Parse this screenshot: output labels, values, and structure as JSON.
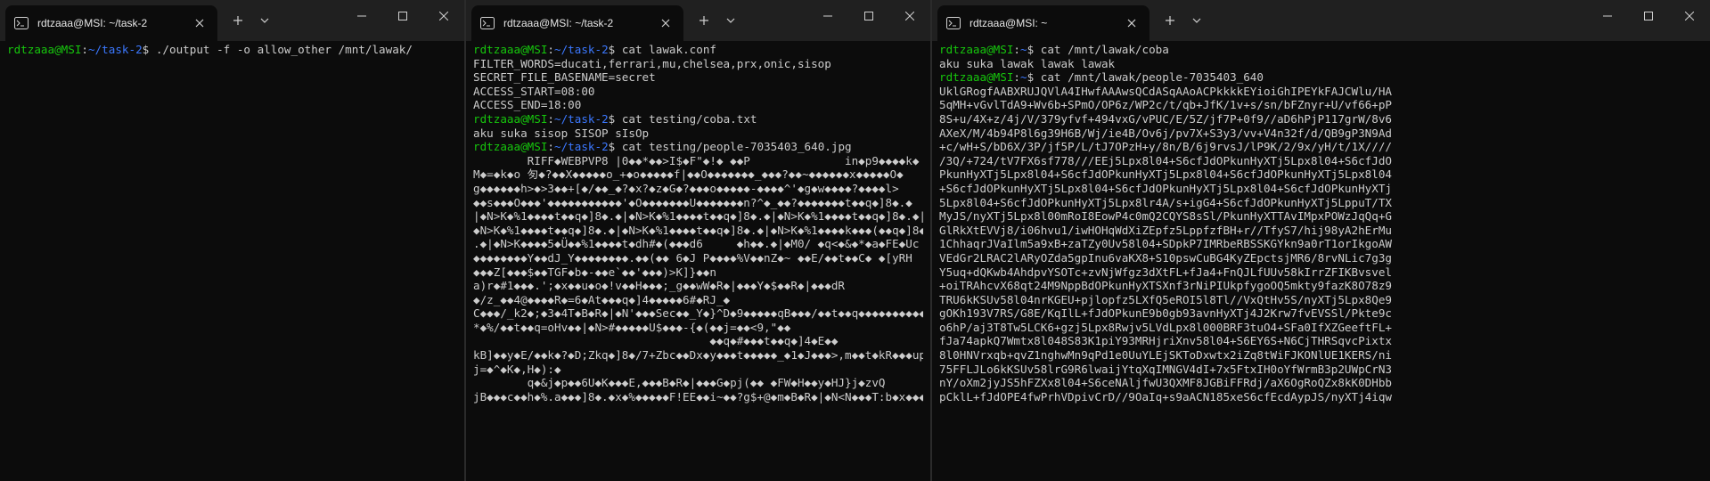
{
  "windows": [
    {
      "tab_title": "rdtzaaa@MSI: ~/task-2",
      "lines": [
        {
          "type": "prompt",
          "user": "rdtzaaa@MSI",
          "colon": ":",
          "path": "~/task-2",
          "dollar": "$ ",
          "cmd": "./output -f -o allow_other /mnt/lawak/"
        }
      ]
    },
    {
      "tab_title": "rdtzaaa@MSI: ~/task-2",
      "lines": [
        {
          "type": "prompt",
          "user": "rdtzaaa@MSI",
          "colon": ":",
          "path": "~/task-2",
          "dollar": "$ ",
          "cmd": "cat lawak.conf"
        },
        {
          "type": "out",
          "text": "FILTER_WORDS=ducati,ferrari,mu,chelsea,prx,onic,sisop"
        },
        {
          "type": "out",
          "text": "SECRET_FILE_BASENAME=secret"
        },
        {
          "type": "out",
          "text": "ACCESS_START=08:00"
        },
        {
          "type": "out",
          "text": "ACCESS_END=18:00"
        },
        {
          "type": "prompt",
          "user": "rdtzaaa@MSI",
          "colon": ":",
          "path": "~/task-2",
          "dollar": "$ ",
          "cmd": "cat testing/coba.txt"
        },
        {
          "type": "out",
          "text": "aku suka sisop SISOP sIsOp"
        },
        {
          "type": "prompt",
          "user": "rdtzaaa@MSI",
          "colon": ":",
          "path": "~/task-2",
          "dollar": "$ ",
          "cmd": "cat testing/people-7035403_640.jpg"
        },
        {
          "type": "out",
          "text": "        RIFF◆WEBPVP8 |0◆◆*◆◆>I$◆F\"◆!◆ ◆◆P              in◆p9◆◆◆◆k◆"
        },
        {
          "type": "out",
          "text": "M◆=◆k◆o 匇◆?◆◆X◆◆◆◆◆o_+◆o◆◆◆◆◆f|◆◆O◆◆◆◆◆◆◆_◆◆◆?◆◆~◆◆◆◆◆◆x◆◆◆◆◆O◆"
        },
        {
          "type": "out",
          "text": "g◆◆◆◆◆◆h>◆>3◆◆+[◆/◆◆_◆?◆x?◆z◆G◆?◆◆◆o◆◆◆◆◆-◆◆◆◆^'◆g◆w◆◆◆◆?◆◆◆◆l>"
        },
        {
          "type": "out",
          "text": "◆◆s◆◆◆O◆◆◆'◆◆◆◆◆◆◆◆◆◆◆'◆O◆◆◆◆◆◆◆U◆◆◆◆◆◆◆n?^◆_◆◆?◆◆◆◆◆◆◆t◆◆q◆]8◆.◆"
        },
        {
          "type": "out",
          "text": "|◆N>K◆%1◆◆◆◆t◆◆q◆]8◆.◆|◆N>K◆%1◆◆◆◆t◆◆q◆]8◆.◆|◆N>K◆%1◆◆◆◆t◆◆q◆]8◆.◆|"
        },
        {
          "type": "out",
          "text": "◆N>K◆%1◆◆◆◆t◆◆q◆]8◆.◆|◆N>K◆%1◆◆◆◆t◆◆q◆]8◆.◆|◆N>K◆%1◆◆◆◆k◆◆◆(◆◆q◆]8◆"
        },
        {
          "type": "out",
          "text": ".◆|◆N>K◆◆◆◆5◆Ü◆◆%1◆◆◆◆t◆dh#◆(◆◆◆d6     ◆h◆◆.◆|◆M0/ ◆q<◆&◆*◆a◆FE◆Uc"
        },
        {
          "type": "out",
          "text": "◆◆◆◆◆◆◆◆Y◆◆dJ_Y◆◆◆◆◆◆◆◆.◆◆(◆◆ 6◆J P◆◆◆◆%V◆◆nZ◆~ ◆◆E/◆◆t◆◆C◆ ◆[yRH"
        },
        {
          "type": "out",
          "text": "◆◆◆Z[◆◆◆$◆◆TGF◆b◆-◆◆e`◆◆'◆◆◆)>K]}◆◆n"
        },
        {
          "type": "out",
          "text": "a)r◆#1◆◆◆.';◆x◆◆u◆o◆!v◆◆H◆◆◆;_g◆◆wW◆R◆|◆◆◆Y◆$◆◆R◆|◆◆◆dR"
        },
        {
          "type": "out",
          "text": "◆/z_◆◆4@◆◆◆◆R◆=6◆At◆◆◆q◆]4◆◆◆◆◆6#◆RJ_◆"
        },
        {
          "type": "out",
          "text": "C◆◆◆/_k2◆;◆3◆4T◆B◆R◆|◆N'◆◆◆Sec◆◆_Y◆}^D◆9◆◆◆◆◆qB◆◆◆/◆◆t◆◆q◆◆◆◆◆◆◆◆◆◆?"
        },
        {
          "type": "out",
          "text": "*◆%/◆◆t◆◆q=oHv◆◆|◆N>#◆◆◆◆◆U$◆◆◆-{◆(◆◆j=◆◆<9,\"◆◆"
        },
        {
          "type": "out",
          "text": "                                   ◆◆q◆#◆◆◆t◆◆q◆]4◆E◆◆"
        },
        {
          "type": "out",
          "text": "kB]◆◆y◆E/◆◆k◆?◆D;Zkq◆]8◆/7+Zbc◆◆Dx◆y◆◆◆t◆◆◆◆◆_◆1◆J◆◆◆>,m◆◆t◆kR◆◆◆up2"
        },
        {
          "type": "out",
          "text": "j=◆^◆K◆,H◆):◆"
        },
        {
          "type": "out",
          "text": "        q◆&j◆p◆◆6U◆K◆◆◆E,◆◆◆B◆R◆|◆◆◆G◆pj(◆◆ ◆FW◆H◆◆y◆HJ}j◆zvQ"
        },
        {
          "type": "out",
          "text": "jB◆◆◆c◆◆h◆%.a◆◆◆]8◆.◆x◆%◆◆◆◆◆F!EE◆◆i~◆◆?g$+@◆m◆B◆R◆|◆N<N◆◆◆T:b◆x◆◆◆"
        }
      ]
    },
    {
      "tab_title": "rdtzaaa@MSI: ~",
      "lines": [
        {
          "type": "prompt",
          "user": "rdtzaaa@MSI",
          "colon": ":",
          "path": "~",
          "dollar": "$ ",
          "cmd": "cat /mnt/lawak/coba"
        },
        {
          "type": "out",
          "text": "aku suka lawak lawak lawak"
        },
        {
          "type": "prompt",
          "user": "rdtzaaa@MSI",
          "colon": ":",
          "path": "~",
          "dollar": "$ ",
          "cmd": "cat /mnt/lawak/people-7035403_640"
        },
        {
          "type": "out",
          "text": "UklGRogfAABXRUJQVlA4IHwfAAAwsQCdASqAAoACPkkkkEYioiGhIPEYkFAJCWlu/HA"
        },
        {
          "type": "out",
          "text": "5qMH+vGvlTdA9+Wv6b+SPmO/OP6z/WP2c/t/qb+JfK/1v+s/sn/bFZnyr+U/vf66+pP"
        },
        {
          "type": "out",
          "text": "8S+u/4X+z/4j/V/379yfvf+494vxG/vPUC/E/5Z/jf7P+0f9//aD6hPjP117grW/8v6"
        },
        {
          "type": "out",
          "text": "AXeX/M/4b94P8l6g39H6B/Wj/ie4B/Ov6j/pv7X+S3y3/vv+V4n32f/d/QB9gP3N9Ad"
        },
        {
          "type": "out",
          "text": "+c/wH+S/bD6X/3P/jf5P/L/tJ7OPzH+y/8n/B/6j9rvsJ/lP9K/2/9x/yH/t/1X////"
        },
        {
          "type": "out",
          "text": "/3Q/+724/tV7FX6sf778///EEj5Lpx8l04+S6cfJdOPkunHyXTj5Lpx8l04+S6cfJdO"
        },
        {
          "type": "out",
          "text": "PkunHyXTj5Lpx8l04+S6cfJdOPkunHyXTj5Lpx8l04+S6cfJdOPkunHyXTj5Lpx8l04"
        },
        {
          "type": "out",
          "text": "+S6cfJdOPkunHyXTj5Lpx8l04+S6cfJdOPkunHyXTj5Lpx8l04+S6cfJdOPkunHyXTj"
        },
        {
          "type": "out",
          "text": "5Lpx8l04+S6cfJdOPkunHyXTj5Lpx8lr4A/s+igG4+S6cfJdOPkunHyXTj5LppuT/TX"
        },
        {
          "type": "out",
          "text": "MyJS/nyXTj5Lpx8l00mRoI8EowP4c0mQ2CQYS8sSl/PkunHyXTTAvIMpxPOWzJqQq+G"
        },
        {
          "type": "out",
          "text": "GlRkXtEVVj8/i06hvu1/iwHOHqWdXiZEpfz5LppfzfBH+r//TfyS7/hij98yA2hErMu"
        },
        {
          "type": "out",
          "text": "1ChhaqrJVaIlm5a9xB+zaTZy0Uv58l04+SDpkP7IMRbeRBSSKGYkn9a0rT1orIkgoAW"
        },
        {
          "type": "out",
          "text": "VEdGr2LRAC2lARyOZda5gpInu6vaKX8+S10pswCuBG4KyZEpctsjMR6/8rvNLic7g3g"
        },
        {
          "type": "out",
          "text": "Y5uq+dQKwb4AhdpvYSOTc+zvNjWfgz3dXtFL+fJa4+FnQJLfUUv58kIrrZFIKBvsvel"
        },
        {
          "type": "out",
          "text": "+oiTRAhcvX68qt24M9NppBdOPkunHyXTSXnf3rNiPIUkpfygoOQ5mkty9fazK8O78z9"
        },
        {
          "type": "out",
          "text": "TRU6kKSUv58l04nrKGEU+pjlopfz5LXfQ5eROI5l8Tl//VxQtHv5S/nyXTj5Lpx8Qe9"
        },
        {
          "type": "out",
          "text": "gOKh193V7RS/G8E/KqIlL+fJdOPkunE9b0gb93avnHyXTj4J2Krw7fvEVSSl/Pkte9c"
        },
        {
          "type": "out",
          "text": "o6hP/aj3T8Tw5LCK6+gzj5Lpx8Rwjv5LVdLpx8l000BRF3tuO4+SFa0IfXZGeeftFL+"
        },
        {
          "type": "out",
          "text": "fJa74apkQ7Wmtx8l048S83K1piY93MRHjriXnv58l04+S6EY6S+N6CjTHRSqvcPixtx"
        },
        {
          "type": "out",
          "text": "8l0HNVrxqb+qvZ1nghwMn9qPd1e0UuYLEjSKToDxwtx2iZq8tWiFJKONlUE1KERS/ni"
        },
        {
          "type": "out",
          "text": "75FFLJLo6kKSUv58lrG9R6lwaijYtqXqIMNGV4dI+7x5FtxIH0oYfWrmB3p2UWpCrN3"
        },
        {
          "type": "out",
          "text": "nY/oXm2jyJS5hFZXx8l04+S6ceNAljfwU3QXMF8JGBiFFRdj/aX6OgRoQZx8kK0DHbb"
        },
        {
          "type": "out",
          "text": "pCklL+fJdOPE4fwPrhVDpivCrD//9OaIq+s9aACN185xeS6cfEcdAypJS/nyXTj4iqw"
        }
      ]
    }
  ]
}
